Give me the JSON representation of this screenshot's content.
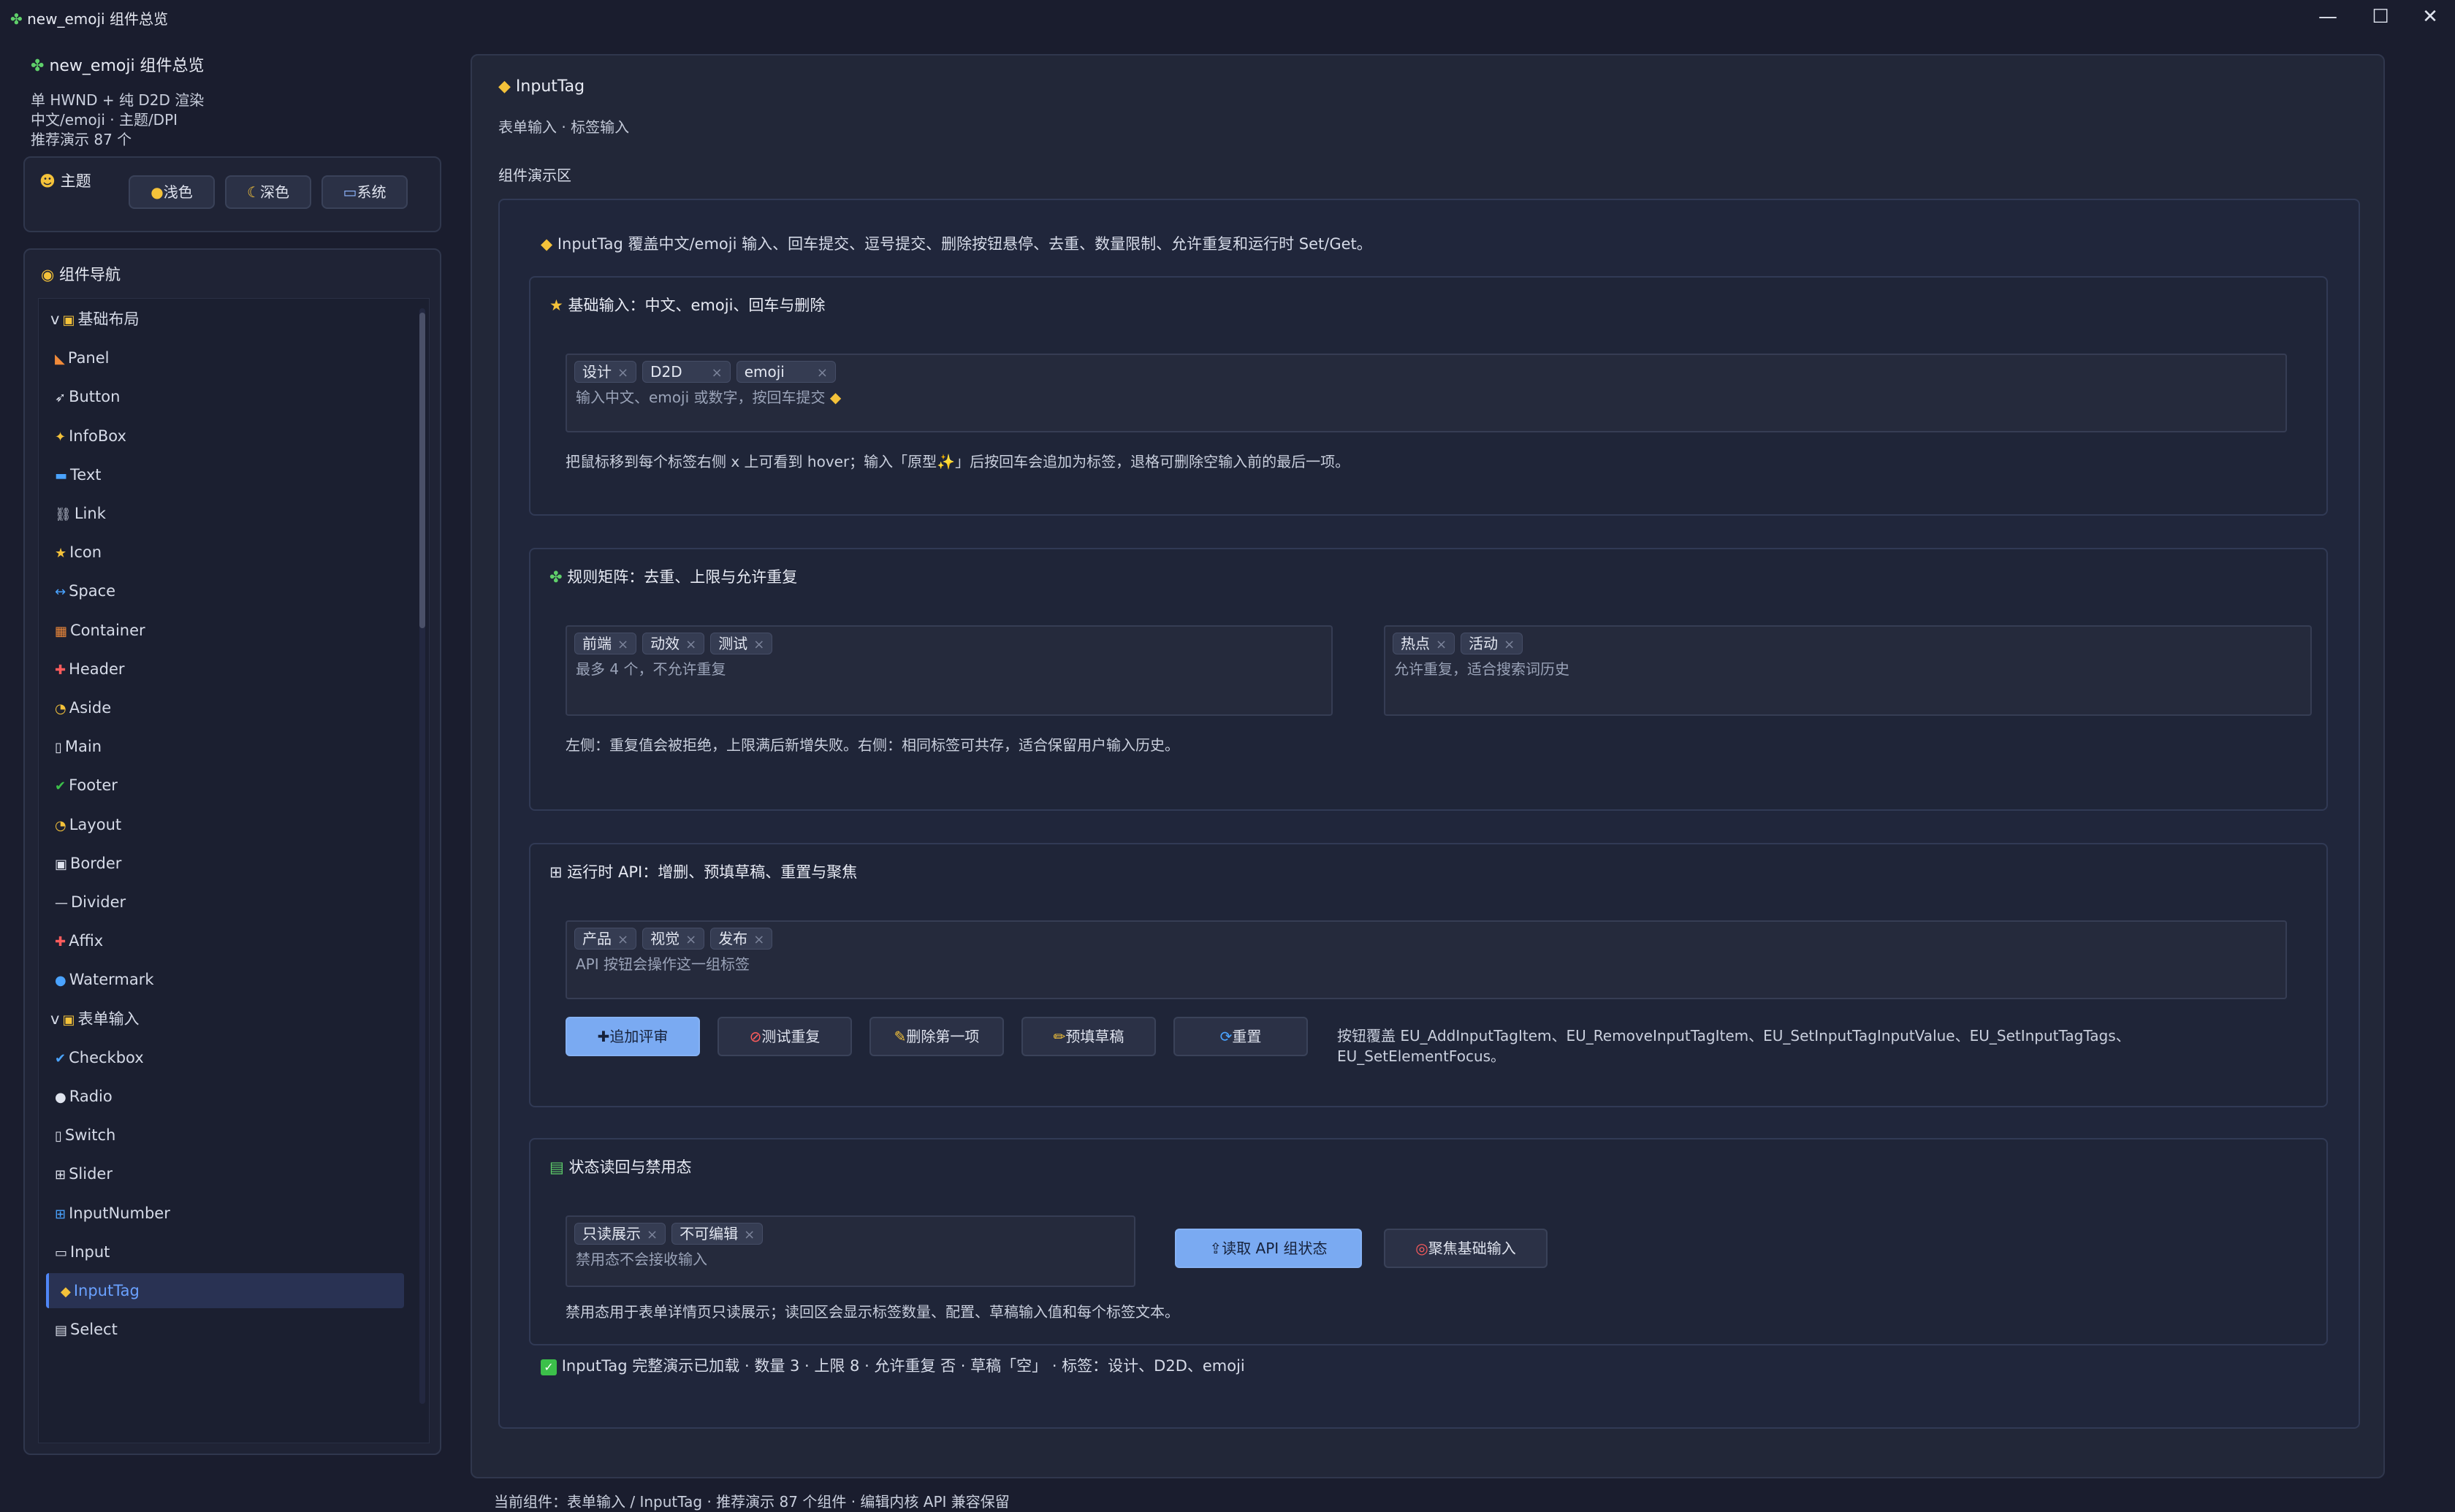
{
  "window": {
    "title": "new_emoji 组件总览",
    "minimize": "—",
    "maximize": "☐",
    "close": "✕"
  },
  "sidebar": {
    "title": "new_emoji 组件总览",
    "info": [
      "单 HWND + 纯 D2D 渲染",
      "中文/emoji · 主题/DPI",
      "推荐演示 87 个"
    ],
    "theme": {
      "label": "主题",
      "light": "浅色",
      "dark": "深色",
      "system": "系统"
    },
    "nav": {
      "label": "组件导航",
      "items": [
        {
          "label": "基础布局",
          "kind": "group"
        },
        {
          "label": "Panel"
        },
        {
          "label": "Button"
        },
        {
          "label": "InfoBox"
        },
        {
          "label": "Text"
        },
        {
          "label": "Link"
        },
        {
          "label": "Icon"
        },
        {
          "label": "Space"
        },
        {
          "label": "Container"
        },
        {
          "label": "Header"
        },
        {
          "label": "Aside"
        },
        {
          "label": "Main"
        },
        {
          "label": "Footer"
        },
        {
          "label": "Layout"
        },
        {
          "label": "Border"
        },
        {
          "label": "Divider"
        },
        {
          "label": "Affix"
        },
        {
          "label": "Watermark"
        },
        {
          "label": "表单输入",
          "kind": "group"
        },
        {
          "label": "Checkbox"
        },
        {
          "label": "Radio"
        },
        {
          "label": "Switch"
        },
        {
          "label": "Slider"
        },
        {
          "label": "InputNumber"
        },
        {
          "label": "Input"
        },
        {
          "label": "InputTag",
          "active": true
        },
        {
          "label": "Select"
        }
      ]
    }
  },
  "main": {
    "title": "InputTag",
    "subtitle": "表单输入 · 标签输入",
    "demo_label": "组件演示区",
    "intro": "InputTag 覆盖中文/emoji 输入、回车提交、逗号提交、删除按钮悬停、去重、数量限制、允许重复和运行时 Set/Get。",
    "sections": {
      "basic": {
        "title": "基础输入：中文、emoji、回车与删除",
        "tags": [
          "设计",
          "D2D",
          "emoji"
        ],
        "placeholder": "输入中文、emoji 或数字，按回车提交",
        "note": "把鼠标移到每个标签右侧 x 上可看到 hover；输入「原型✨」后按回车会追加为标签，退格可删除空输入前的最后一项。"
      },
      "rules": {
        "title": "规则矩阵：去重、上限与允许重复",
        "left_tags": [
          "前端",
          "动效",
          "测试"
        ],
        "left_placeholder": "最多 4 个，不允许重复",
        "right_tags": [
          "热点",
          "活动"
        ],
        "right_placeholder": "允许重复，适合搜索词历史",
        "note": "左侧：重复值会被拒绝，上限满后新增失败。右侧：相同标签可共存，适合保留用户输入历史。"
      },
      "api": {
        "title": "运行时 API：增删、预填草稿、重置与聚焦",
        "tags": [
          "产品",
          "视觉",
          "发布"
        ],
        "placeholder": "API 按钮会操作这一组标签",
        "buttons": [
          "追加评审",
          "测试重复",
          "删除第一项",
          "预填草稿",
          "重置"
        ],
        "note_line1": "按钮覆盖 EU_AddInputTagItem、EU_RemoveInputTagItem、EU_SetInputTagInputValue、EU_SetInputTagTags、",
        "note_line2": "EU_SetElementFocus。"
      },
      "state": {
        "title": "状态读回与禁用态",
        "tags": [
          "只读展示",
          "不可编辑"
        ],
        "placeholder": "禁用态不会接收输入",
        "read_button": "读取 API 组状态",
        "focus_button": "聚焦基础输入",
        "note": "禁用态用于表单详情页只读展示；读回区会显示标签数量、配置、草稿输入值和每个标签文本。"
      }
    },
    "status": "InputTag 完整演示已加载 · 数量 3 · 上限 8 · 允许重复 否 · 草稿「空」 · 标签：设计、D2D、emoji"
  },
  "footer": "当前组件：表单输入 / InputTag · 推荐演示 87 个组件 · 编辑内核 API 兼容保留"
}
